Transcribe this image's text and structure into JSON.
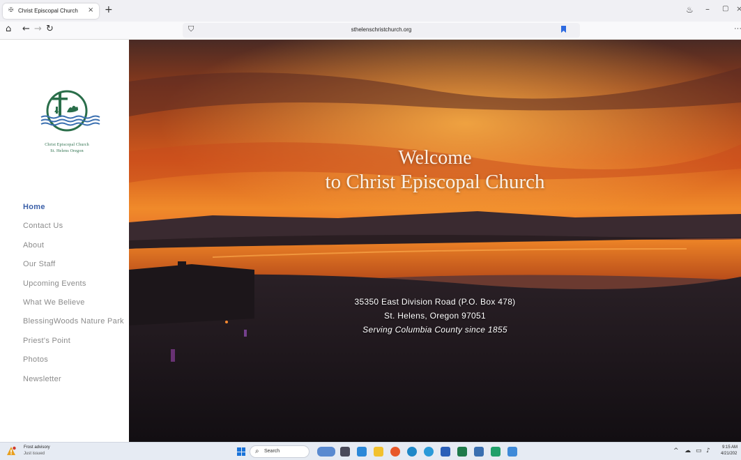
{
  "browser": {
    "tab_title": "Christ Episcopal Church",
    "tab_icon": "church-favicon",
    "url": "sthelenschristchurch.org"
  },
  "site": {
    "logo": {
      "name_line": "Christ Episcopal Church",
      "place_line": "St. Helens Oregon",
      "colors": {
        "green": "#2a6e4a",
        "blue": "#3a6fb0"
      }
    },
    "nav": [
      {
        "label": "Home",
        "active": true
      },
      {
        "label": "Contact Us"
      },
      {
        "label": "About"
      },
      {
        "label": "Our Staff"
      },
      {
        "label": "Upcoming Events"
      },
      {
        "label": "What We Believe"
      },
      {
        "label": "BlessingWoods Nature Park"
      },
      {
        "label": "Priest's Point"
      },
      {
        "label": "Photos"
      },
      {
        "label": "Newsletter"
      }
    ],
    "nav_active_color": "#3a5fa8",
    "nav_color": "#8a8a8a"
  },
  "hero": {
    "title_line1": "Welcome",
    "title_line2": "to Christ Episcopal Church",
    "address_line1": "35350 East Division Road (P.O. Box 478)",
    "address_line2": "St. Helens, Oregon 97051",
    "tagline": "Serving Columbia County since 1855"
  },
  "taskbar": {
    "weather_title": "Frost advisory",
    "weather_sub": "Just issued",
    "search_placeholder": "Search",
    "time": "9:15 AM",
    "date": "4/21/202"
  }
}
